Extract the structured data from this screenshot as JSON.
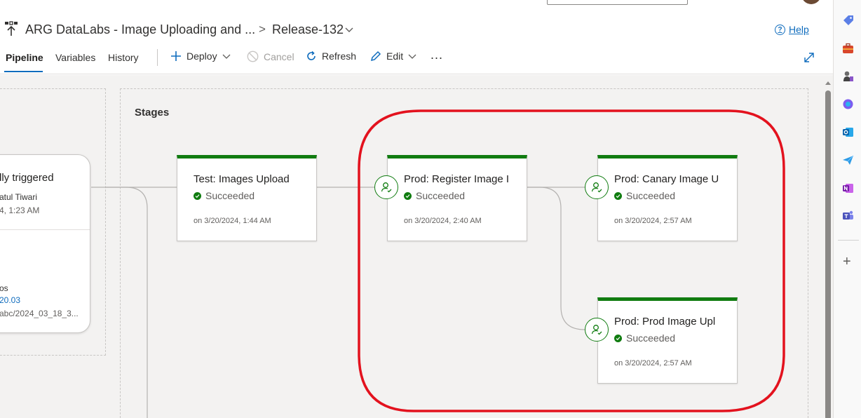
{
  "header": {
    "pipeline_title": "ARG DataLabs - Image Uploading and ...",
    "breadcrumb_separator": ">",
    "release_name": "Release-132",
    "help_label": "Help"
  },
  "tabs": [
    {
      "label": "Pipeline",
      "selected": true
    },
    {
      "label": "Variables",
      "selected": false
    },
    {
      "label": "History",
      "selected": false
    }
  ],
  "toolbar": {
    "deploy_label": "Deploy",
    "cancel_label": "Cancel",
    "cancel_enabled": false,
    "refresh_label": "Refresh",
    "edit_label": "Edit",
    "more_label": "..."
  },
  "artifacts": {
    "trigger_title": "lly triggered",
    "triggered_by": "atul Tiwari",
    "trigger_time": "4, 1:23 AM",
    "artifact_name": "os",
    "artifact_version": "20.03",
    "artifact_branch": "abc/2024_03_18_3..."
  },
  "stages_label": "Stages",
  "stages": {
    "test": {
      "name": "Test: Images Upload",
      "status": "Succeeded",
      "date": "on 3/20/2024, 1:44 AM",
      "has_approval": false
    },
    "register": {
      "name": "Prod: Register Image I",
      "status": "Succeeded",
      "date": "on 3/20/2024, 2:40 AM",
      "has_approval": true
    },
    "canary": {
      "name": "Prod: Canary Image U",
      "status": "Succeeded",
      "date": "on 3/20/2024, 2:57 AM",
      "has_approval": true
    },
    "prod": {
      "name": "Prod: Prod Image Upl",
      "status": "Succeeded",
      "date": "on 3/20/2024, 2:57 AM",
      "has_approval": true
    }
  },
  "colors": {
    "accent": "#0f6cbd",
    "success": "#107c10",
    "highlight_annotation": "#e3121e"
  },
  "sidebar_icons": [
    "tag-icon",
    "briefcase-icon",
    "chess-icon",
    "copilot-icon",
    "outlook-icon",
    "send-icon",
    "onenote-icon",
    "teams-icon",
    "add-icon"
  ]
}
